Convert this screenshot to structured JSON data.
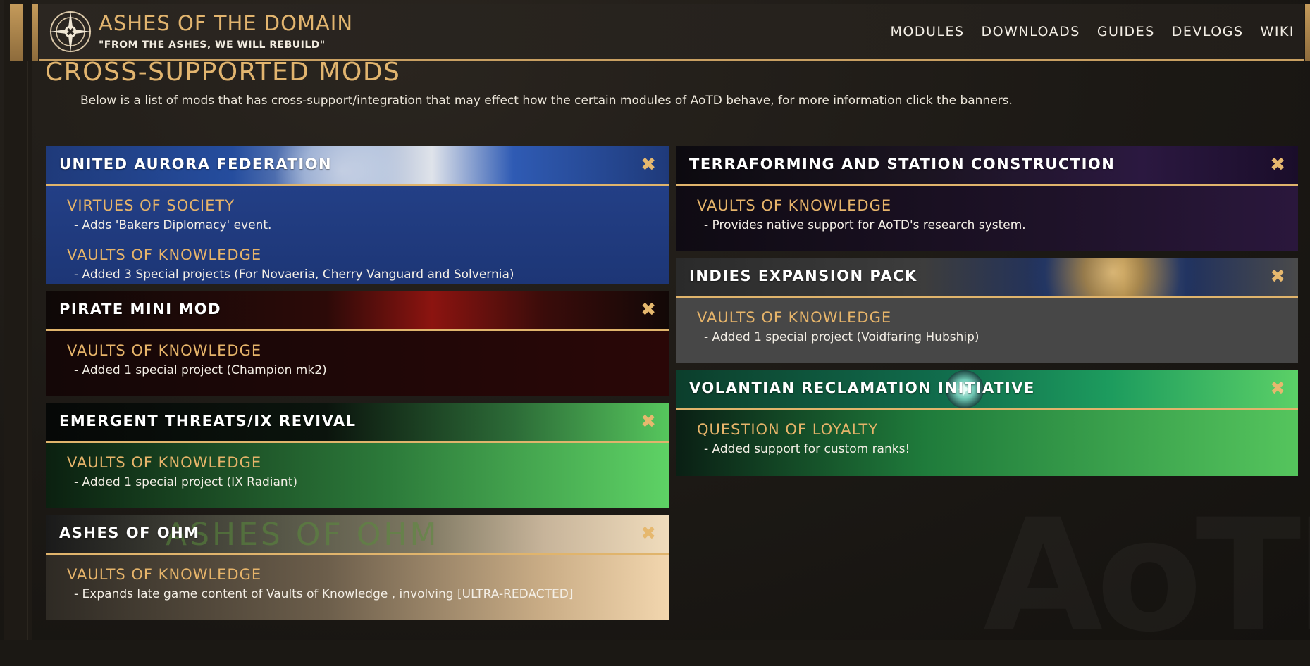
{
  "header": {
    "title": "ASHES OF THE DOMAIN",
    "tagline": "\"FROM THE ASHES, WE WILL REBUILD\"",
    "nav": [
      {
        "label": "MODULES"
      },
      {
        "label": "DOWNLOADS"
      },
      {
        "label": "GUIDES"
      },
      {
        "label": "DEVLOGS"
      },
      {
        "label": "WIKI"
      }
    ]
  },
  "main": {
    "title": "CROSS-SUPPORTED MODS",
    "intro": "Below is a list of mods that has cross-support/integration that may effect how the certain modules of AoTD behave, for more information click the banners.",
    "toggle_glyph": "✖",
    "watermark": "AoTD",
    "left_cards": [
      {
        "name": "UNITED AURORA FEDERATION",
        "entries": [
          {
            "module": "VIRTUES OF SOCIETY",
            "desc": "- Adds 'Bakers Diplomacy' event."
          },
          {
            "module": "VAULTS OF KNOWLEDGE",
            "desc": "- Added 3 Special projects (For Novaeria, Cherry Vanguard and Solvernia)"
          }
        ]
      },
      {
        "name": "PIRATE MINI MOD",
        "entries": [
          {
            "module": "VAULTS OF KNOWLEDGE",
            "desc": "- Added 1 special project (Champion mk2)"
          }
        ]
      },
      {
        "name": "EMERGENT THREATS/IX REVIVAL",
        "entries": [
          {
            "module": "VAULTS OF KNOWLEDGE",
            "desc": "- Added 1 special project (IX Radiant)"
          }
        ]
      },
      {
        "name": "ASHES OF OHM",
        "banner_text": "ASHES OF OHM",
        "entries": [
          {
            "module": "VAULTS OF KNOWLEDGE",
            "desc": "- Expands late game content of Vaults of Knowledge , involving [ULTRA-REDACTED]"
          }
        ]
      }
    ],
    "right_cards": [
      {
        "name": "TERRAFORMING AND STATION CONSTRUCTION",
        "entries": [
          {
            "module": "VAULTS OF KNOWLEDGE",
            "desc": "- Provides native support for AoTD's research system."
          }
        ]
      },
      {
        "name": "INDIES EXPANSION PACK",
        "entries": [
          {
            "module": "VAULTS OF KNOWLEDGE",
            "desc": "- Added 1 special project (Voidfaring Hubship)"
          }
        ]
      },
      {
        "name": "VOLANTIAN RECLAMATION INITIATIVE",
        "entries": [
          {
            "module": "QUESTION OF LOYALTY",
            "desc": "- Added support for custom ranks!"
          }
        ]
      }
    ]
  },
  "colors": {
    "accent": "#e2b56f",
    "background": "#1b1814"
  }
}
